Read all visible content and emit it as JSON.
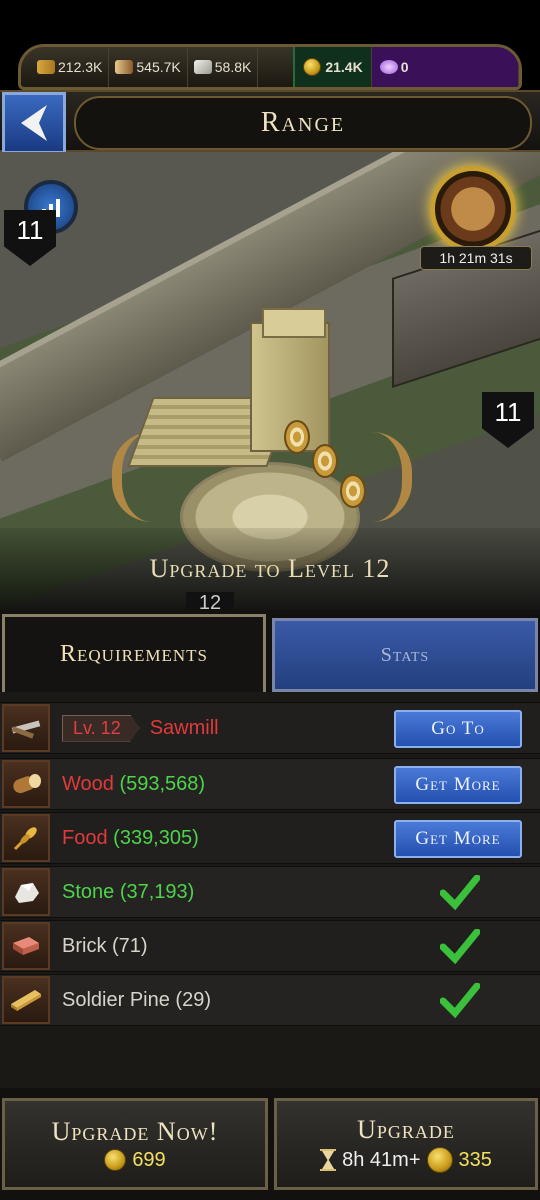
{
  "resources": {
    "food": "212.3K",
    "wood": "545.7K",
    "stone": "58.8K",
    "gold": "21.4K",
    "gems": "0"
  },
  "header": {
    "title": "Range"
  },
  "scene": {
    "timer": "1h 21m 31s",
    "badge_left": "11",
    "badge_right": "11",
    "level_peek": "12",
    "banner": "Upgrade to Level 12"
  },
  "tabs": {
    "requirements": "Requirements",
    "stats": "Stats"
  },
  "requirements": [
    {
      "icon": "saw-icon",
      "level": "Lv. 12",
      "name": "Sawmill",
      "button": "Go To"
    },
    {
      "icon": "log-icon",
      "name": "Wood",
      "amount": "(593,568)",
      "button": "Get More"
    },
    {
      "icon": "wheat-icon",
      "name": "Food",
      "amount": "(339,305)",
      "button": "Get More"
    },
    {
      "icon": "stone-icon",
      "name": "Stone",
      "amount": "(37,193)",
      "met": true
    },
    {
      "icon": "brick-icon",
      "name": "Brick",
      "amount": "(71)",
      "met": true
    },
    {
      "icon": "plank-icon",
      "name": "Soldier Pine",
      "amount": "(29)",
      "met": true
    }
  ],
  "bottom": {
    "upgrade_now": "Upgrade Now!",
    "upgrade_now_cost": "699",
    "upgrade": "Upgrade",
    "upgrade_time": "8h 41m+",
    "upgrade_cost": "335"
  },
  "colors": {
    "accent_blue": "#2a5ab8",
    "requirement_missing": "#e03a3a",
    "requirement_met": "#4cd44a"
  }
}
